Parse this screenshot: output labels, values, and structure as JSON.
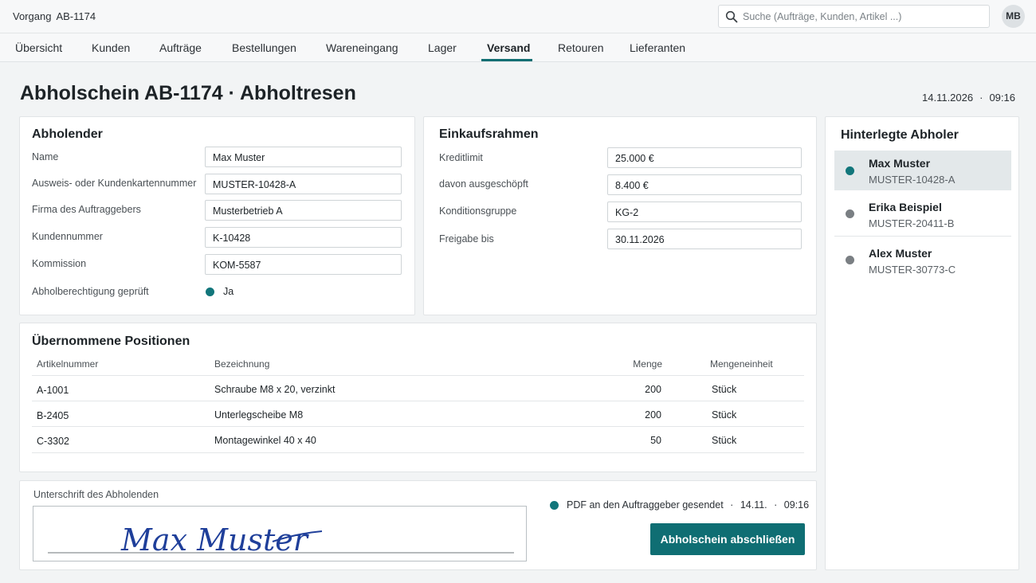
{
  "header": {
    "vorgang_label": "Vorgang",
    "vorgang_id": "AB-1174",
    "search_placeholder": "Suche (Aufträge, Kunden, Artikel ...)",
    "avatar_initials": "MB"
  },
  "nav": {
    "tabs": [
      {
        "label": "Übersicht"
      },
      {
        "label": "Kunden"
      },
      {
        "label": "Aufträge"
      },
      {
        "label": "Bestellungen"
      },
      {
        "label": "Wareneingang"
      },
      {
        "label": "Lager"
      },
      {
        "label": "Versand",
        "active": true
      },
      {
        "label": "Retouren"
      },
      {
        "label": "Lieferanten"
      }
    ]
  },
  "page": {
    "title": "Abholschein AB-1174 · Abholtresen",
    "date": "14.11.2026",
    "date_sep": "·",
    "time": "09:16"
  },
  "abholender": {
    "title": "Abholender",
    "fields": [
      {
        "label": "Name",
        "value": "Max Muster"
      },
      {
        "label": "Ausweis- oder Kundenkartennummer",
        "value": "MUSTER-10428-A"
      },
      {
        "label": "Firma des Auftraggebers",
        "value": "Musterbetrieb A"
      },
      {
        "label": "Kundennummer",
        "value": "K-10428"
      },
      {
        "label": "Kommission",
        "value": "KOM-5587"
      }
    ],
    "check_label": "Abholberechtigung geprüft",
    "check_value": "Ja"
  },
  "einkaufsrahmen": {
    "title": "Einkaufsrahmen",
    "fields": [
      {
        "label": "Kreditlimit",
        "value": "25.000 €"
      },
      {
        "label": "davon ausgeschöpft",
        "value": "8.400 €"
      },
      {
        "label": "Konditionsgruppe",
        "value": "KG-2"
      },
      {
        "label": "Freigabe bis",
        "value": "30.11.2026"
      }
    ]
  },
  "abholer": {
    "title": "Hinterlegte Abholer",
    "items": [
      {
        "name": "Max Muster",
        "id": "MUSTER-10428-A",
        "selected": true
      },
      {
        "name": "Erika Beispiel",
        "id": "MUSTER-20411-B"
      },
      {
        "name": "Alex Muster",
        "id": "MUSTER-30773-C"
      }
    ]
  },
  "positionen": {
    "title": "Übernommene Positionen",
    "columns": [
      "Artikelnummer",
      "Bezeichnung",
      "Menge",
      "Mengeneinheit"
    ],
    "rows": [
      [
        "A-1001",
        "Schraube M8 x 20, verzinkt",
        "200",
        "Stück"
      ],
      [
        "B-2405",
        "Unterlegscheibe M8",
        "200",
        "Stück"
      ],
      [
        "C-3302",
        "Montagewinkel 40 x 40",
        "50",
        "Stück"
      ]
    ]
  },
  "signature": {
    "label": "Unterschrift des Abholenden",
    "signed_name": "Max Muster",
    "pdf_status": "PDF an den Auftraggeber gesendet",
    "pdf_sep": "·",
    "pdf_date": "14.11.",
    "pdf_sep2": "·",
    "pdf_time": "09:16",
    "button_label": "Abholschein abschließen"
  },
  "colors": {
    "accent": "#0f6e73",
    "status_ok": "#12767b",
    "status_neutral": "#7a7f83"
  }
}
